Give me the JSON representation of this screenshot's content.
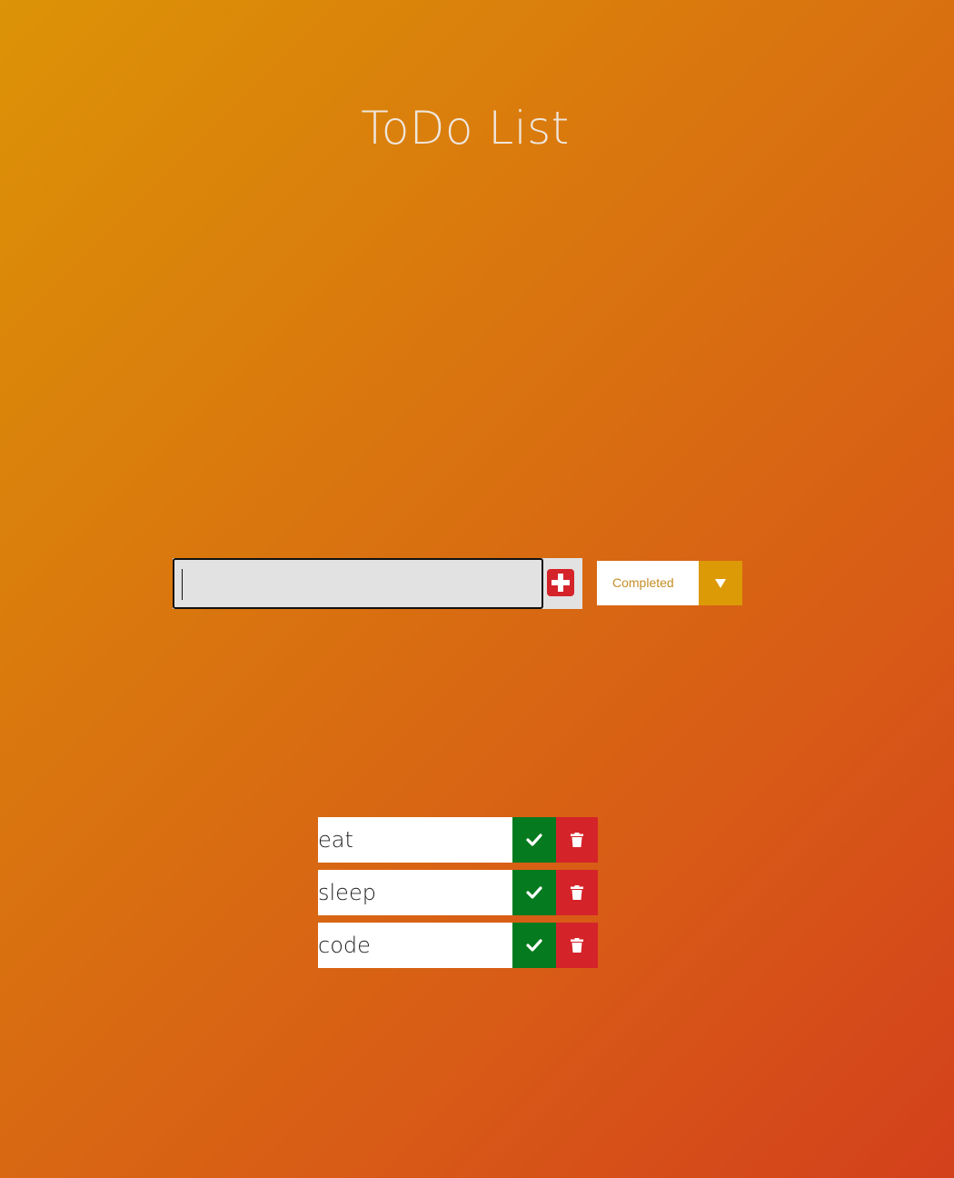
{
  "header": {
    "title": "ToDo List"
  },
  "form": {
    "input_value": "",
    "add_icon": "plus-square-icon",
    "filter": {
      "selected": "Completed",
      "arrow_icon": "triangle-down-icon"
    }
  },
  "todos": [
    {
      "text": "eat",
      "complete_icon": "check-icon",
      "delete_icon": "trash-icon"
    },
    {
      "text": "sleep",
      "complete_icon": "check-icon",
      "delete_icon": "trash-icon"
    },
    {
      "text": "code",
      "complete_icon": "check-icon",
      "delete_icon": "trash-icon"
    }
  ],
  "colors": {
    "background_start": "#dc9306",
    "background_end": "#d3401c",
    "complete": "#057a1e",
    "delete": "#d5232a",
    "filter_accent": "#dc9a06"
  }
}
